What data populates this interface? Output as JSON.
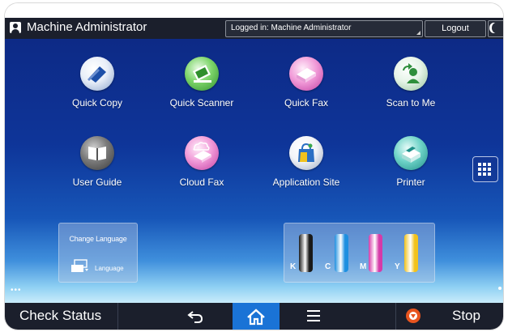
{
  "header": {
    "title": "Machine Administrator",
    "login_status": "Logged in: Machine Administrator",
    "logout_label": "Logout"
  },
  "apps": [
    {
      "label": "Quick Copy",
      "icon": "copy-icon"
    },
    {
      "label": "Quick Scanner",
      "icon": "scanner-icon"
    },
    {
      "label": "Quick Fax",
      "icon": "fax-icon"
    },
    {
      "label": "Scan to Me",
      "icon": "scan-to-me-icon"
    },
    {
      "label": "User Guide",
      "icon": "book-icon"
    },
    {
      "label": "Cloud Fax",
      "icon": "cloud-fax-icon"
    },
    {
      "label": "Application Site",
      "icon": "shopping-bag-icon"
    },
    {
      "label": "Printer",
      "icon": "printer-icon"
    }
  ],
  "widgets": {
    "language_title": "Change Language",
    "language_label": "Language",
    "toner": [
      {
        "letter": "K",
        "color": "#1a1a1a"
      },
      {
        "letter": "C",
        "color": "#1d8fe0"
      },
      {
        "letter": "M",
        "color": "#d63aa8"
      },
      {
        "letter": "Y",
        "color": "#f2c21b"
      }
    ]
  },
  "bottom": {
    "check_status": "Check Status",
    "stop": "Stop"
  },
  "colors": {
    "bar": "#1b1f2c",
    "home_active": "#1a73d6",
    "stop": "#e8541e"
  }
}
